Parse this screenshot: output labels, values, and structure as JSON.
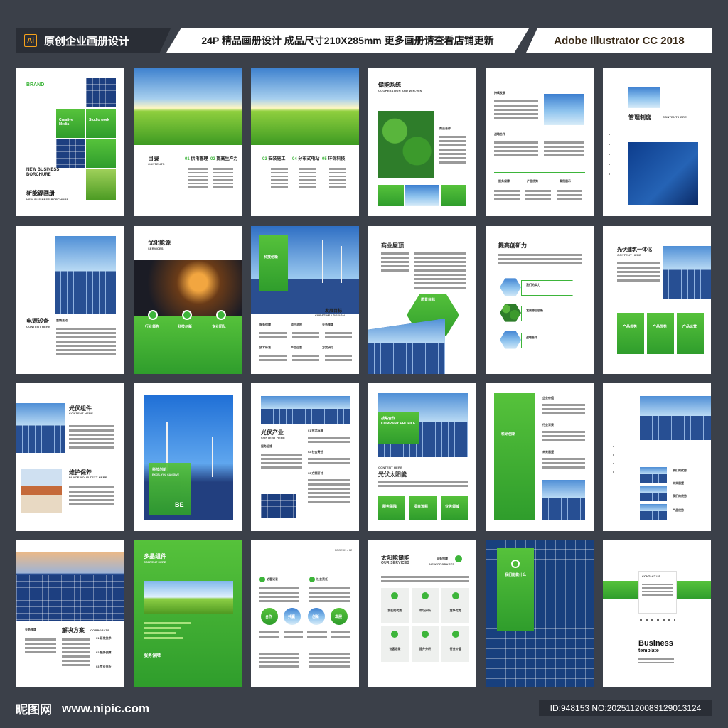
{
  "banner": {
    "ai_icon": "Ai",
    "left": "原创企业画册设计",
    "middle": "24P 精品画册设计 成品尺寸210X285mm 更多画册请查看店铺更新",
    "right": "Adobe Illustrator CC 2018"
  },
  "pages": {
    "p1": {
      "brand": "BRAND",
      "title_en": "NEW BUSINESS BORCHURE",
      "title_cn": "新能源画册",
      "sub": "NEW BUSINESS BORCHURE",
      "tile_a": "Creative Media",
      "tile_b": "Studio work",
      "tile_c": "Studio work"
    },
    "p2": {
      "toc": "目录",
      "toc_en": "CONTENTS",
      "s1": "供电管理",
      "s2": "提高生产力"
    },
    "p3": {
      "s3": "安装施工",
      "s4": "分布式电站",
      "s5": "环保科技"
    },
    "p4": {
      "title": "储能系统",
      "sub": "COOPERATION AND WIN-WIN",
      "label": "商业合作"
    },
    "p5": {
      "t1": "持续发展",
      "t2": "战略合作",
      "a": "服务保障",
      "b": "产品优势",
      "c": "案例展示"
    },
    "p6": {
      "title": "管理制度",
      "sub": "CONTENT HERE"
    },
    "p7": {
      "title": "电源设备",
      "sub": "CONTENT HERE",
      "label": "营销活动"
    },
    "p8": {
      "title": "优化能源",
      "sub": "SERVICES",
      "a": "行业领先",
      "b": "科技创新",
      "c": "专业团队"
    },
    "p9": {
      "panel": "科技创新",
      "goal": "发展目标",
      "goal_en": "CREATIVE / DESIGN",
      "a": "服务保障",
      "b": "项目流程",
      "c": "业务领域",
      "d": "技术标准",
      "e": "产品运营",
      "f": "方案研讨"
    },
    "p10": {
      "title": "商业屋顶",
      "hex": "愿景目标"
    },
    "p11": {
      "title": "提高创新力",
      "a": "我们的实力",
      "b": "发展源自创新",
      "c": "战略合作"
    },
    "p12": {
      "title": "光伏建筑一体化",
      "sub": "CONTENT HERE",
      "a": "产品优势",
      "b": "产品优势",
      "c": "产品运营"
    },
    "p13": {
      "t1": "光伏组件",
      "s1": "CONTENT HERE",
      "t2": "维护保养",
      "s2": "PLACE YOUR TEXT HERE"
    },
    "p14": {
      "box": "科技创新",
      "box_en": "EXCEL YOU CAN GIVE",
      "mark": "BE"
    },
    "p15": {
      "title": "光伏产业",
      "sub": "CONTENT HERE",
      "sub2": "服务运维",
      "n1": "01 技术标准",
      "n2": "02 社会责任",
      "n3": "03 方案研讨"
    },
    "p16": {
      "box": "战略合作",
      "box_en": "COMPANY PROFILE",
      "sub": "CONTENT HERE",
      "title": "光伏太阳能",
      "a": "服务保障",
      "b": "项目流程",
      "c": "业务领域"
    },
    "p17": {
      "v": "科研创新",
      "a": "企业价值",
      "b": "行业背景",
      "c": "未来展望"
    },
    "p18": {
      "a": "我们的优势",
      "b": "未来展望",
      "c": "我们的优势",
      "d": "产品优势"
    },
    "p19": {
      "a": "业务领域",
      "title": "解决方案",
      "sub": "CORPORATE",
      "n1": "01 研发技术",
      "n2": "02 服务保障",
      "n3": "03 专业分析"
    },
    "p20": {
      "title": "多晶组件",
      "sub": "CONTENT HERE",
      "bottom": "服务保障"
    },
    "p21": {
      "page": "PAGE 01 / 02",
      "a": "访客记录",
      "b": "社会责任",
      "c1": "合作",
      "c2": "共赢",
      "c3": "创新",
      "c4": "发展"
    },
    "p22": {
      "title": "太阳能储能",
      "sub": "OUR SERVICES",
      "r": "业务领域",
      "r_en": "NEW PRODUCTS",
      "a": "我们的优势",
      "b": "市场分析",
      "c": "竞争优势",
      "d": "访客记录",
      "e": "提升分析",
      "f": "行业价值"
    },
    "p23": {
      "box": "我们能做什么"
    },
    "p24": {
      "contact": "CONTACT US",
      "title": "Business",
      "title2": "template"
    }
  },
  "footer": {
    "logo": "昵图网",
    "url": "www.nipic.com",
    "id": "ID:948153 NO:20251120083129013124"
  }
}
